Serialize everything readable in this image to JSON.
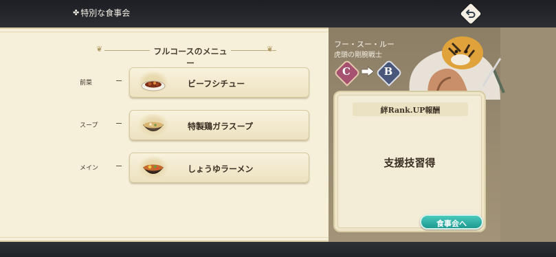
{
  "header": {
    "title": "特別な食事会",
    "back_icon": "return-arrow-icon"
  },
  "menu": {
    "heading": "フルコースのメニュー",
    "courses": [
      {
        "label": "前菜",
        "dish": "ビーフシチュー",
        "icon": "beef-stew-icon"
      },
      {
        "label": "スープ",
        "dish": "特製鶏ガラスープ",
        "icon": "chicken-soup-icon"
      },
      {
        "label": "メイン",
        "dish": "しょうゆラーメン",
        "icon": "ramen-icon"
      }
    ]
  },
  "character": {
    "name": "フー・スー・ルー",
    "title": "虎頭の剛腕戦士",
    "rank_from": "C",
    "rank_to": "B"
  },
  "reward": {
    "header": "絆Rank.UP報酬",
    "skill": "支援技習得"
  },
  "action": {
    "dine_label": "食事会へ"
  },
  "colors": {
    "panel_cream": "#f6f0db",
    "accent_teal": "#2fb3a8",
    "rank_c": "#a5516f",
    "rank_b": "#49577a"
  }
}
